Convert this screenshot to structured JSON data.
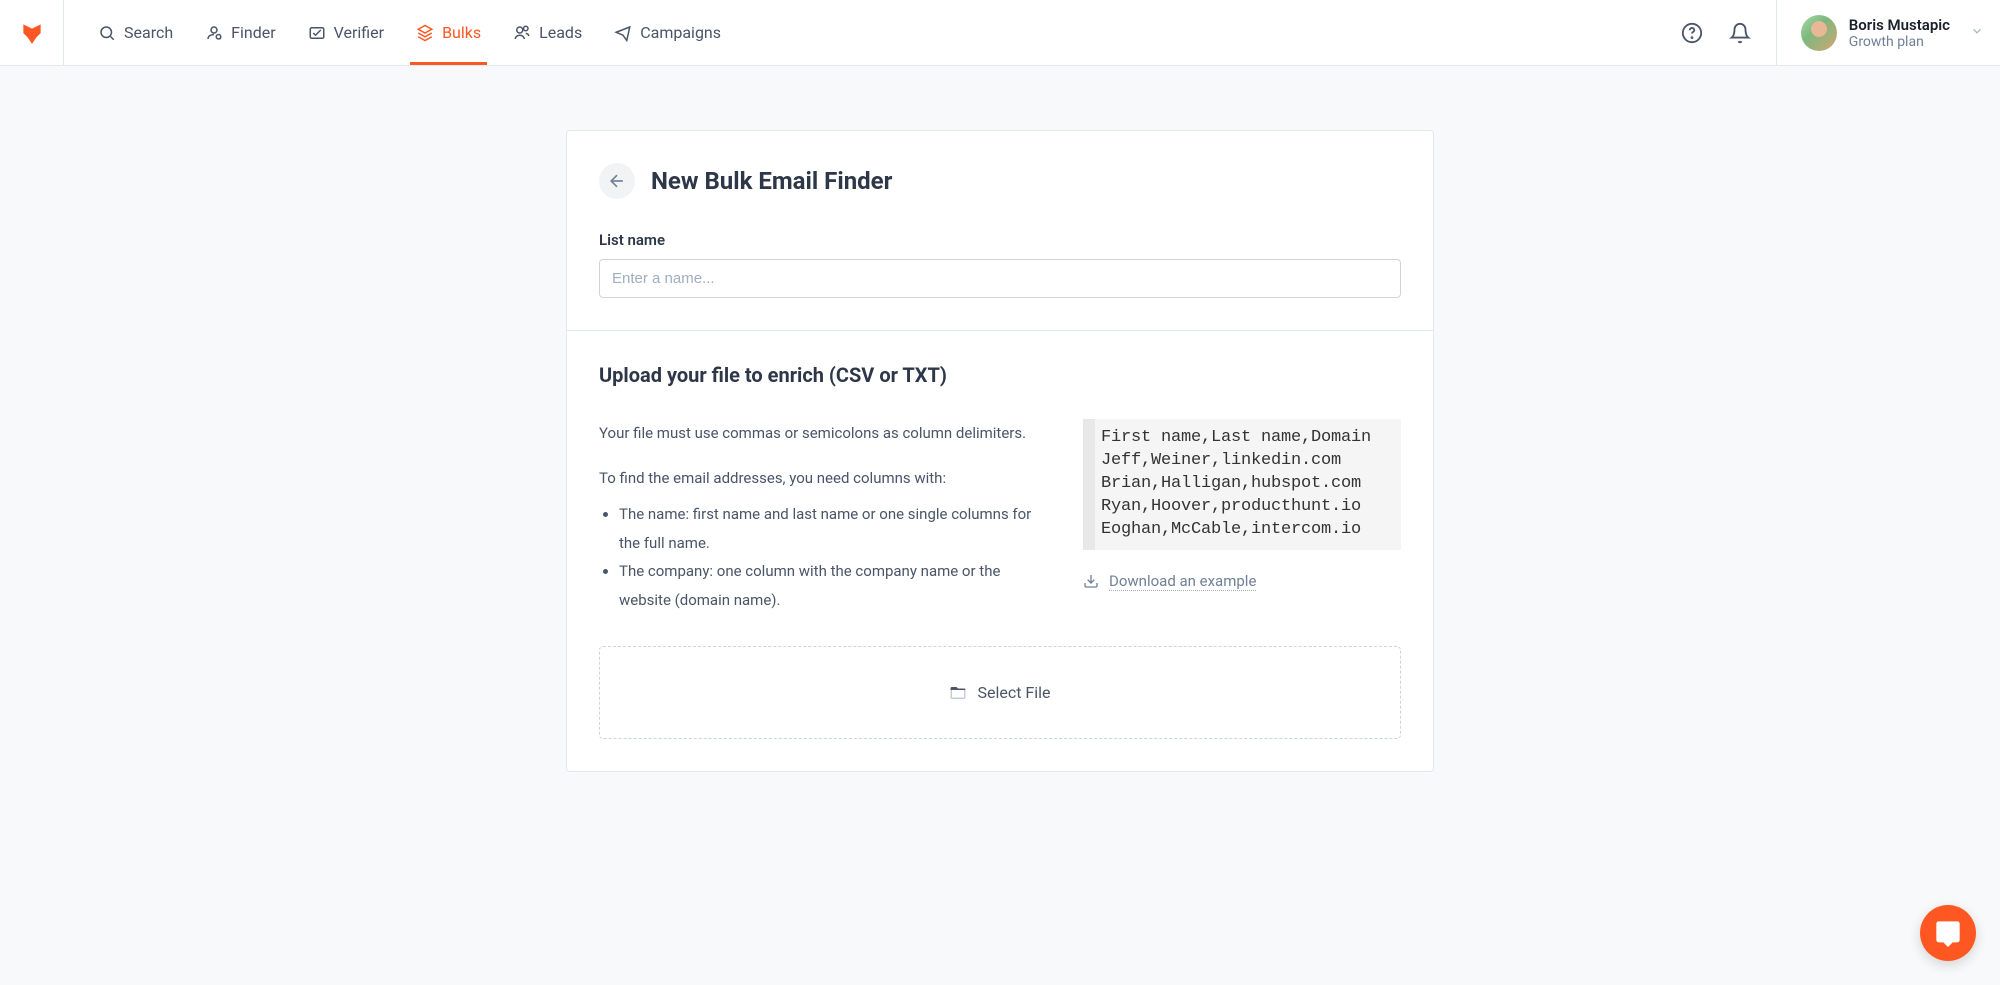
{
  "nav": {
    "items": [
      {
        "label": "Search"
      },
      {
        "label": "Finder"
      },
      {
        "label": "Verifier"
      },
      {
        "label": "Bulks"
      },
      {
        "label": "Leads"
      },
      {
        "label": "Campaigns"
      }
    ]
  },
  "user": {
    "name": "Boris Mustapic",
    "plan": "Growth plan"
  },
  "page": {
    "title": "New Bulk Email Finder",
    "list_name_label": "List name",
    "list_name_placeholder": "Enter a name...",
    "upload_title": "Upload your file to enrich (CSV or TXT)",
    "delimiter_text": "Your file must use commas or semicolons as column delimiters.",
    "columns_intro": "To find the email addresses, you need columns with:",
    "bullet_name": "The name: first name and last name or one single columns for the full name.",
    "bullet_company": "The company: one column with the company name or the website (domain name).",
    "code_example": "First name,Last name,Domain\nJeff,Weiner,linkedin.com\nBrian,Halligan,hubspot.com\nRyan,Hoover,producthunt.io\nEoghan,McCable,intercom.io",
    "download_label": "Download an example",
    "select_file_label": "Select File"
  }
}
